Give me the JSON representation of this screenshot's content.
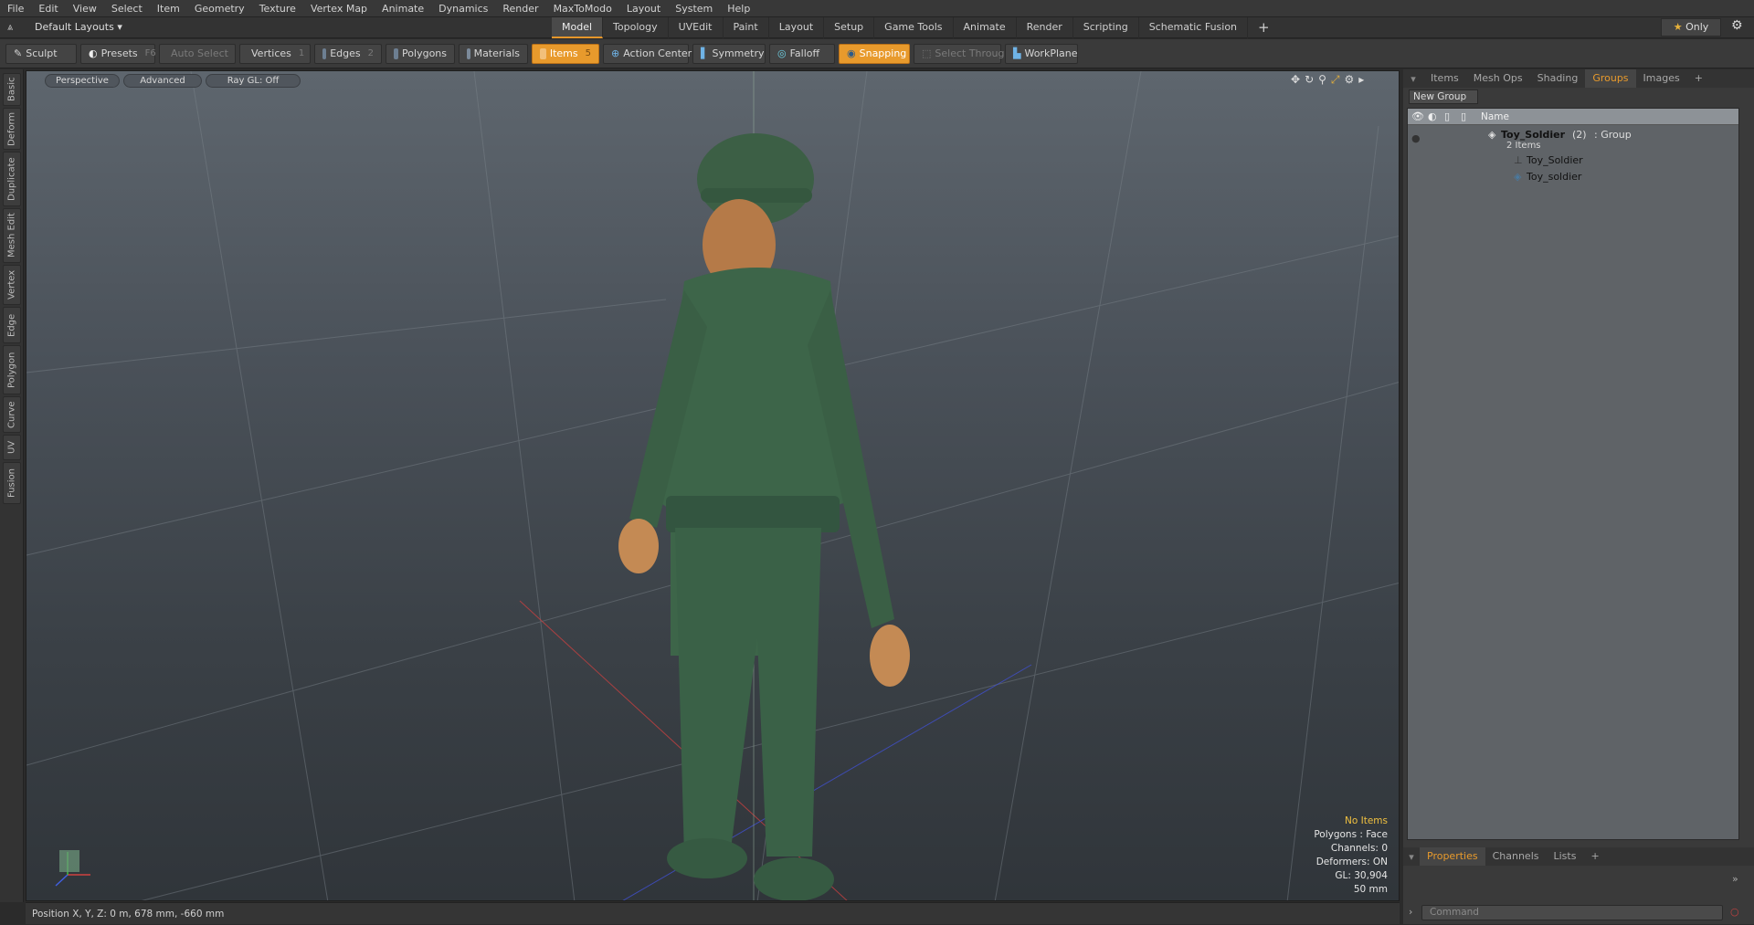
{
  "menubar": [
    "File",
    "Edit",
    "View",
    "Select",
    "Item",
    "Geometry",
    "Texture",
    "Vertex Map",
    "Animate",
    "Dynamics",
    "Render",
    "MaxToModo",
    "Layout",
    "System",
    "Help"
  ],
  "layoutbar": {
    "layout_label": "Default Layouts",
    "tabs": [
      "Model",
      "Topology",
      "UVEdit",
      "Paint",
      "Layout",
      "Setup",
      "Game Tools",
      "Animate",
      "Render",
      "Scripting",
      "Schematic Fusion"
    ],
    "only_label": "Only"
  },
  "toolbar": {
    "sculpt": "Sculpt",
    "presets": "Presets",
    "presets_key": "F6",
    "auto_select": "Auto Select",
    "vertices": "Vertices",
    "vertices_count": "1",
    "edges": "Edges",
    "edges_count": "2",
    "polygons": "Polygons",
    "materials": "Materials",
    "items": "Items",
    "items_count": "5",
    "action_center": "Action Center",
    "symmetry": "Symmetry",
    "falloff": "Falloff",
    "snapping": "Snapping",
    "select_through": "Select Through",
    "workplane": "WorkPlane"
  },
  "left_tabs": [
    "Basic",
    "Deform",
    "Duplicate",
    "Mesh Edit",
    "Vertex",
    "Edge",
    "Polygon",
    "Curve",
    "UV",
    "Fusion"
  ],
  "viewport": {
    "perspective": "Perspective",
    "advanced": "Advanced",
    "raygl": "Ray GL: Off",
    "info": {
      "items": "No Items",
      "polygons": "Polygons : Face",
      "channels": "Channels: 0",
      "deformers": "Deformers: ON",
      "gl": "GL: 30,904",
      "focal": "50 mm"
    },
    "colors": {
      "accent": "#e89a2c",
      "soldier": "#3f6b4a",
      "skin": "#c8905a"
    }
  },
  "statusbar": "Position X, Y, Z:  0 m, 678 mm, -660 mm",
  "right_panel": {
    "tabs": [
      "Items",
      "Mesh Ops",
      "Shading",
      "Groups",
      "Images"
    ],
    "active_tab": "Groups",
    "new_group": "New Group",
    "name_header": "Name",
    "group": {
      "name": "Toy_Soldier",
      "count": "(2)",
      "type": ": Group",
      "items_label": "2 Items",
      "children": [
        "Toy_Soldier",
        "Toy_soldier"
      ]
    },
    "bottom_tabs": [
      "Properties",
      "Channels",
      "Lists"
    ],
    "command_placeholder": "Command"
  }
}
